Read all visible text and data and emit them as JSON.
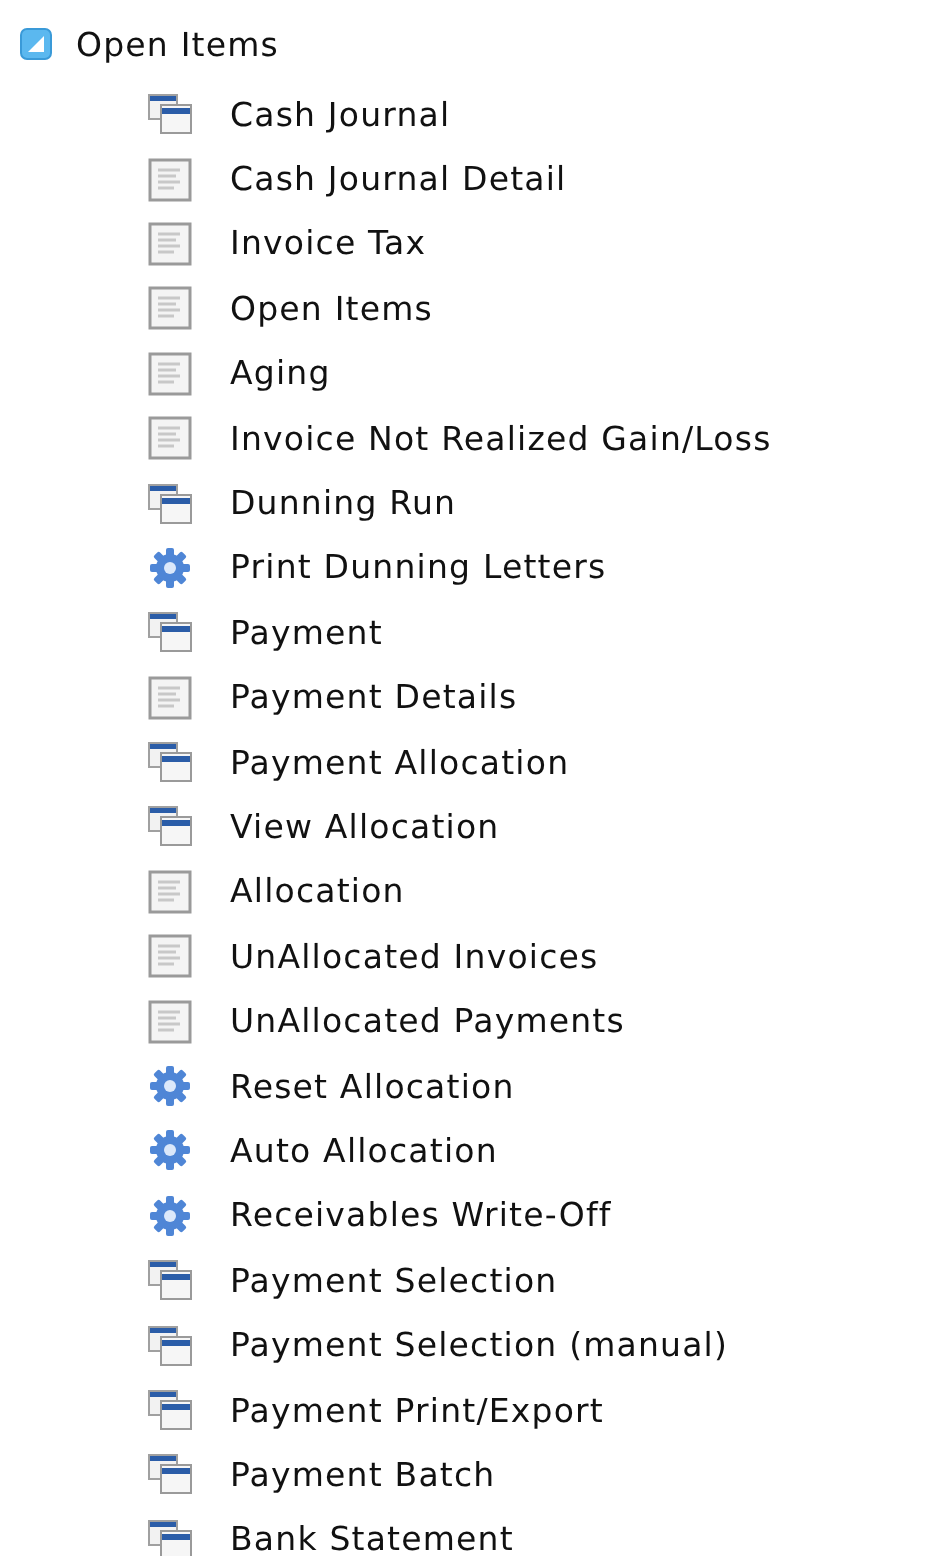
{
  "tree": {
    "label": "Open Items",
    "expanded": true,
    "children": [
      {
        "label": "Cash Journal",
        "kind": "window"
      },
      {
        "label": "Cash Journal Detail",
        "kind": "report"
      },
      {
        "label": "Invoice Tax",
        "kind": "report"
      },
      {
        "label": "Open Items",
        "kind": "report"
      },
      {
        "label": "Aging",
        "kind": "report"
      },
      {
        "label": "Invoice Not Realized Gain/Loss",
        "kind": "report"
      },
      {
        "label": "Dunning Run",
        "kind": "window"
      },
      {
        "label": "Print Dunning Letters",
        "kind": "process"
      },
      {
        "label": "Payment",
        "kind": "window"
      },
      {
        "label": "Payment Details",
        "kind": "report"
      },
      {
        "label": "Payment Allocation",
        "kind": "window"
      },
      {
        "label": "View Allocation",
        "kind": "window"
      },
      {
        "label": "Allocation",
        "kind": "report"
      },
      {
        "label": "UnAllocated Invoices",
        "kind": "report"
      },
      {
        "label": "UnAllocated Payments",
        "kind": "report"
      },
      {
        "label": "Reset Allocation",
        "kind": "process"
      },
      {
        "label": "Auto Allocation",
        "kind": "process"
      },
      {
        "label": "Receivables Write-Off",
        "kind": "process"
      },
      {
        "label": "Payment Selection",
        "kind": "window"
      },
      {
        "label": "Payment Selection (manual)",
        "kind": "window"
      },
      {
        "label": "Payment Print/Export",
        "kind": "window"
      },
      {
        "label": "Payment Batch",
        "kind": "window"
      },
      {
        "label": "Bank Statement",
        "kind": "window"
      }
    ]
  }
}
